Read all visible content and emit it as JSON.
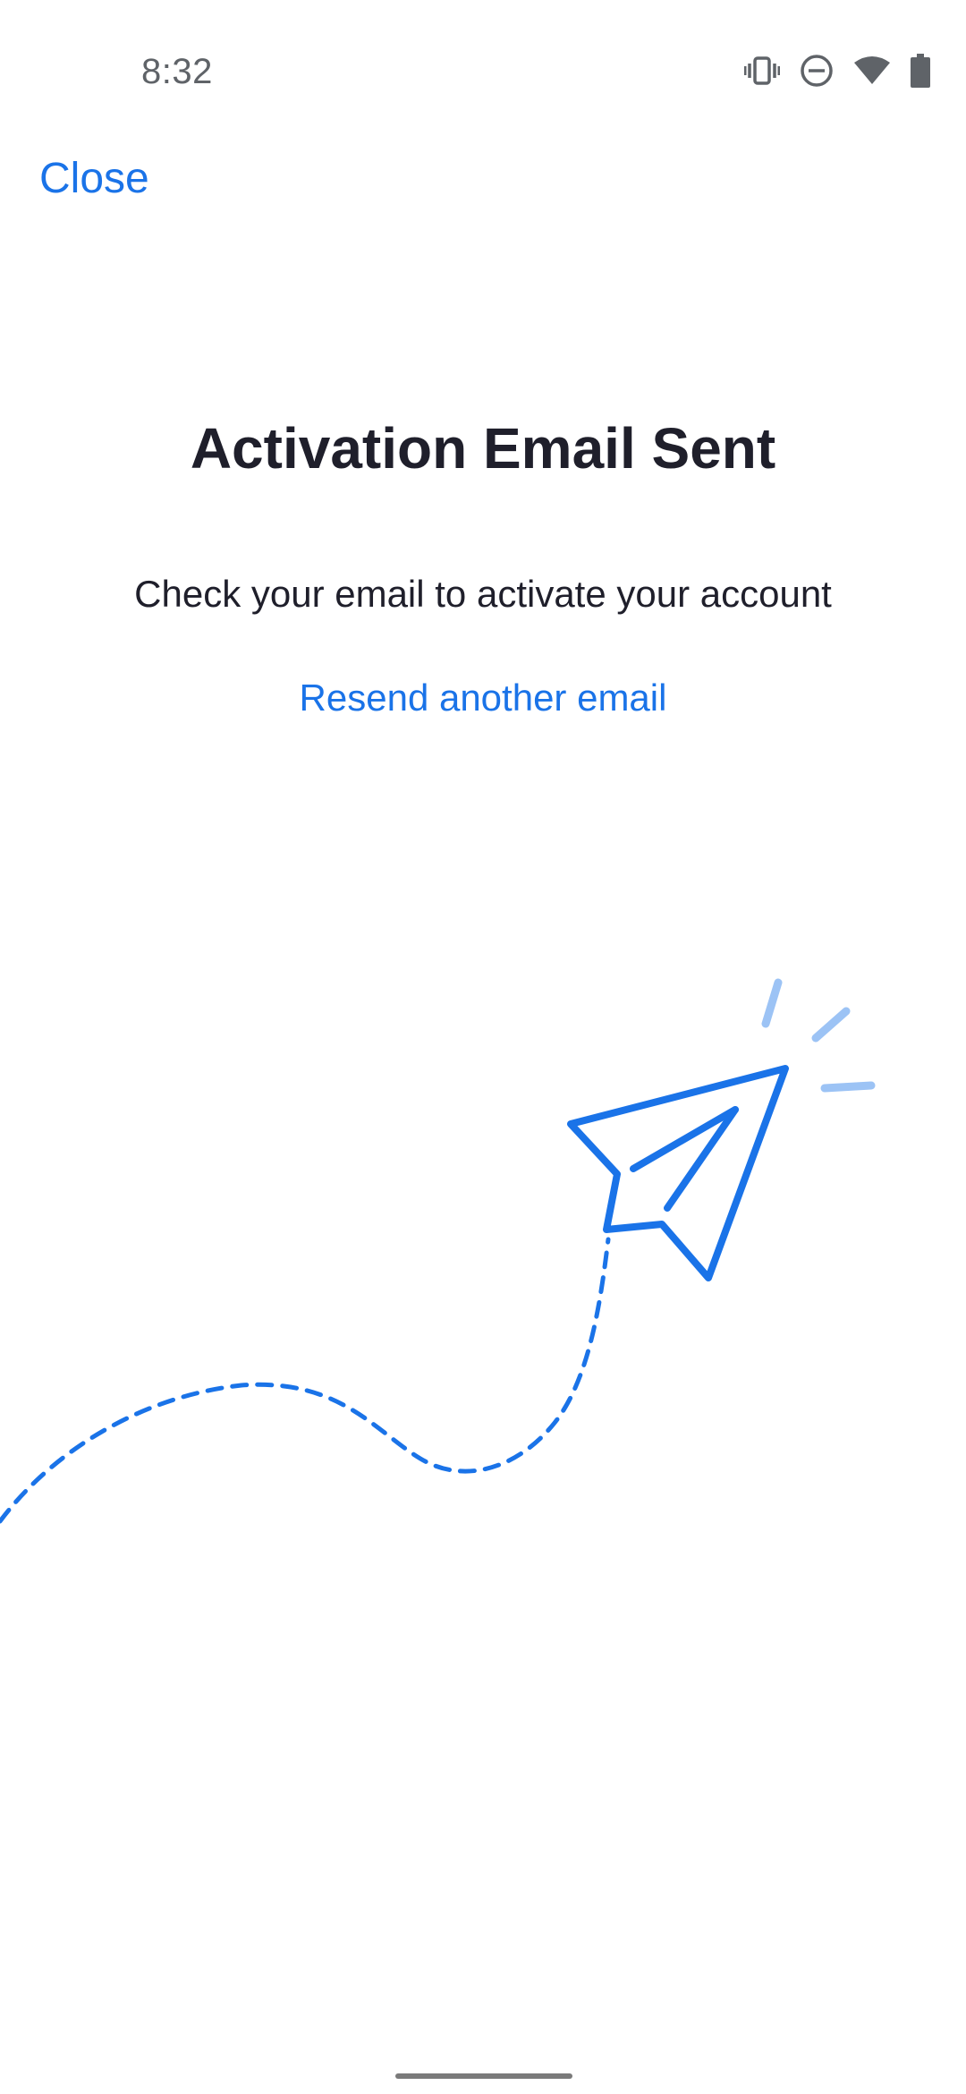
{
  "status_bar": {
    "time": "8:32",
    "icons": [
      "vibrate-icon",
      "do-not-disturb-icon",
      "wifi-icon",
      "battery-icon"
    ]
  },
  "header": {
    "close_label": "Close"
  },
  "main": {
    "title": "Activation Email Sent",
    "subtitle": "Check your email to activate your account",
    "resend_label": "Resend another email"
  },
  "illustration": {
    "icon": "paper-plane-icon"
  },
  "colors": {
    "accent": "#1a73e8",
    "accent_light": "#9cc3f5",
    "text": "#1f1f2b",
    "status_text": "#5f6368"
  }
}
